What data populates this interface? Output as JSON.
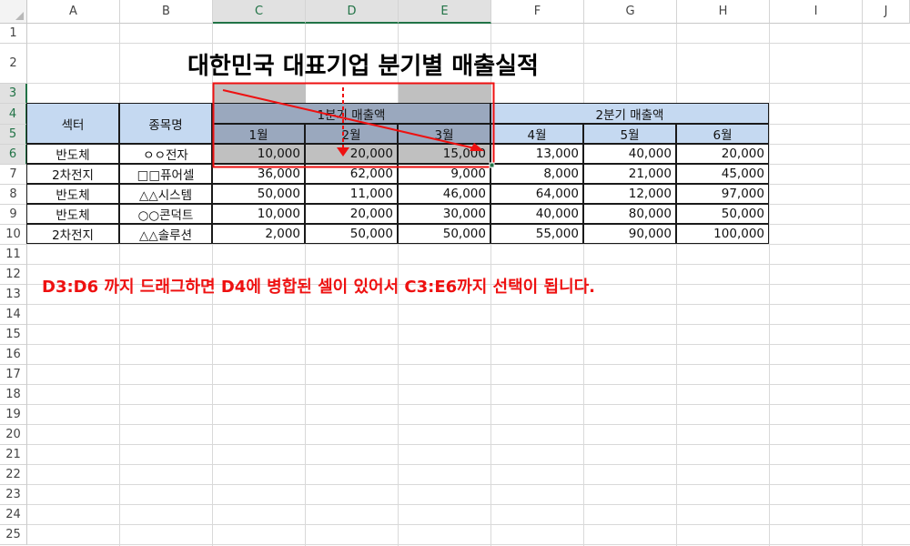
{
  "columns": [
    "A",
    "B",
    "C",
    "D",
    "E",
    "F",
    "G",
    "H",
    "I",
    "J"
  ],
  "rows": [
    "1",
    "2",
    "3",
    "4",
    "5",
    "6",
    "7",
    "8",
    "9",
    "10",
    "11",
    "12",
    "13",
    "14",
    "15",
    "16",
    "17",
    "18",
    "19",
    "20",
    "21",
    "22",
    "23",
    "24",
    "25"
  ],
  "title": "대한민국 대표기업 분기별 매출실적",
  "headers": {
    "sector": "섹터",
    "stock": "종목명",
    "q1": "1분기 매출액",
    "q2": "2분기 매출액",
    "months": [
      "1월",
      "2월",
      "3월",
      "4월",
      "5월",
      "6월"
    ]
  },
  "table": [
    {
      "sector": "반도체",
      "stock": "ㅇㅇ전자",
      "values": [
        "10,000",
        "20,000",
        "15,000",
        "13,000",
        "40,000",
        "20,000"
      ]
    },
    {
      "sector": "2차전지",
      "stock": "□□퓨어셀",
      "values": [
        "36,000",
        "62,000",
        "9,000",
        "8,000",
        "21,000",
        "45,000"
      ]
    },
    {
      "sector": "반도체",
      "stock": "△△시스템",
      "values": [
        "50,000",
        "11,000",
        "46,000",
        "64,000",
        "12,000",
        "97,000"
      ]
    },
    {
      "sector": "반도체",
      "stock": "○○콘덕트",
      "values": [
        "10,000",
        "20,000",
        "30,000",
        "40,000",
        "80,000",
        "50,000"
      ]
    },
    {
      "sector": "2차전지",
      "stock": "△△솔루션",
      "values": [
        "2,000",
        "50,000",
        "50,000",
        "55,000",
        "90,000",
        "100,000"
      ]
    }
  ],
  "note": "D3:D6 까지 드래그하면 D4에 병합된 셀이 있어서 C3:E6까지 선택이 됩니다.",
  "colors": {
    "accent": "#217346",
    "annotation": "#ee1111",
    "header_fill": "#c5d9f1",
    "selection": "#c0c0c0"
  }
}
